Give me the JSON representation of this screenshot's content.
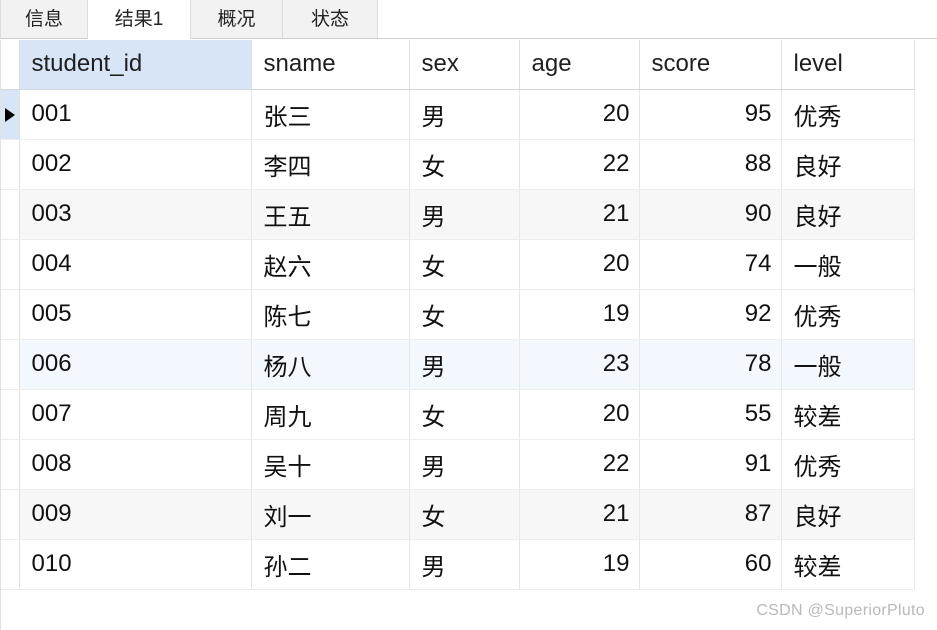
{
  "tabs": [
    {
      "label": "信息",
      "active": false
    },
    {
      "label": "结果1",
      "active": true
    },
    {
      "label": "概况",
      "active": false
    },
    {
      "label": "状态",
      "active": false
    }
  ],
  "grid": {
    "selected_column": "student_id",
    "current_row_index": 0,
    "columns": [
      {
        "key": "student_id",
        "label": "student_id",
        "align": "left"
      },
      {
        "key": "sname",
        "label": "sname",
        "align": "left"
      },
      {
        "key": "sex",
        "label": "sex",
        "align": "left"
      },
      {
        "key": "age",
        "label": "age",
        "align": "right"
      },
      {
        "key": "score",
        "label": "score",
        "align": "right"
      },
      {
        "key": "level",
        "label": "level",
        "align": "left"
      }
    ],
    "rows": [
      {
        "student_id": "001",
        "sname": "张三",
        "sex": "男",
        "age": "20",
        "score": "95",
        "level": "优秀"
      },
      {
        "student_id": "002",
        "sname": "李四",
        "sex": "女",
        "age": "22",
        "score": "88",
        "level": "良好"
      },
      {
        "student_id": "003",
        "sname": "王五",
        "sex": "男",
        "age": "21",
        "score": "90",
        "level": "良好"
      },
      {
        "student_id": "004",
        "sname": "赵六",
        "sex": "女",
        "age": "20",
        "score": "74",
        "level": "一般"
      },
      {
        "student_id": "005",
        "sname": "陈七",
        "sex": "女",
        "age": "19",
        "score": "92",
        "level": "优秀"
      },
      {
        "student_id": "006",
        "sname": "杨八",
        "sex": "男",
        "age": "23",
        "score": "78",
        "level": "一般"
      },
      {
        "student_id": "007",
        "sname": "周九",
        "sex": "女",
        "age": "20",
        "score": "55",
        "level": "较差"
      },
      {
        "student_id": "008",
        "sname": "吴十",
        "sex": "男",
        "age": "22",
        "score": "91",
        "level": "优秀"
      },
      {
        "student_id": "009",
        "sname": "刘一",
        "sex": "女",
        "age": "21",
        "score": "87",
        "level": "良好"
      },
      {
        "student_id": "010",
        "sname": "孙二",
        "sex": "男",
        "age": "19",
        "score": "60",
        "level": "较差"
      }
    ],
    "row_states": [
      "current",
      "normal",
      "band",
      "normal",
      "normal",
      "hl",
      "normal",
      "normal",
      "band",
      "normal"
    ]
  },
  "watermark": {
    "text": "CSDN @SuperiorPluto"
  },
  "colors": {
    "header_selected_bg": "#d7e5f7",
    "band_row_bg": "#f7f7f7",
    "highlight_row_bg": "#f3f8fe",
    "tab_inactive_bg": "#f2f2f2",
    "tab_active_bg": "#ffffff",
    "grid_line": "#e6e6e6",
    "text": "#111111",
    "watermark_text": "#b9b9b9"
  }
}
